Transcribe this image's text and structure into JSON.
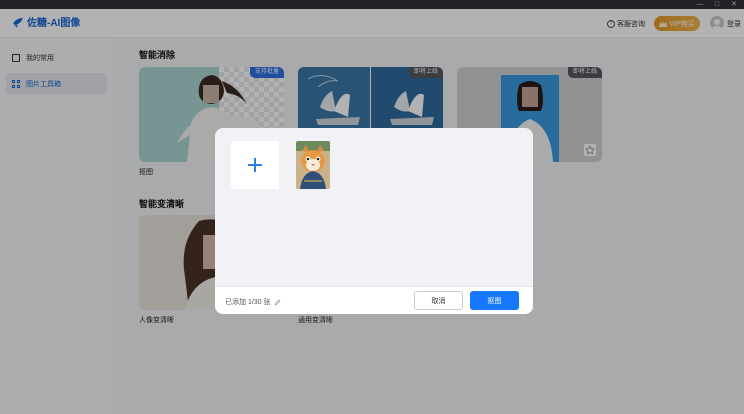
{
  "window": {
    "controls": [
      "—",
      "□",
      "✕"
    ]
  },
  "header": {
    "app_name": "佐糖-AI图像",
    "support_label": "客服咨询",
    "vip_label": "VIP购买",
    "login_label": "登录"
  },
  "sidebar": {
    "items": [
      {
        "label": "我的常用",
        "active": false
      },
      {
        "label": "图片工具箱",
        "active": true
      }
    ]
  },
  "main": {
    "sections": [
      {
        "title": "智能消除",
        "cards": [
          {
            "badge": "支持批量",
            "label": "抠图"
          },
          {
            "badge": "即将上线",
            "label": ""
          },
          {
            "badge": "即将上线",
            "label": ""
          }
        ]
      },
      {
        "title": "智能变清晰",
        "cards": [
          {
            "label": "人像变清晰"
          },
          {
            "label": "通用变清晰"
          }
        ]
      }
    ]
  },
  "dialog": {
    "count_text": "已添加 1/30 张",
    "cancel_label": "取消",
    "confirm_label": "抠图"
  },
  "colors": {
    "brand": "#1a66d6",
    "primary_button": "#1677ff",
    "badge_blue": "#2f6fe6",
    "badge_dark": "#55585e",
    "vip": "#eda63c"
  }
}
